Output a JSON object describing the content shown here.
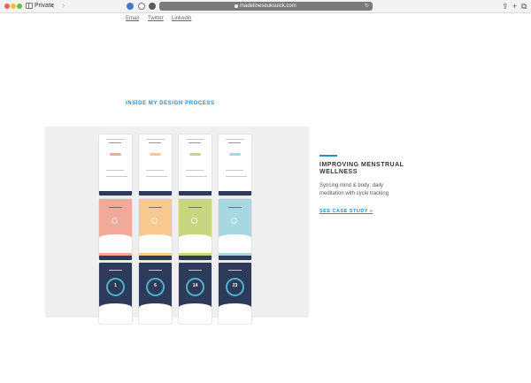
{
  "browser": {
    "mode_label": "Private",
    "address": "madelineseuksuick.com",
    "back_glyph": "‹",
    "forward_glyph": "›",
    "reload_glyph": "↻",
    "share_glyph": "⇪",
    "newtab_glyph": "+",
    "tabs_glyph": "⧉"
  },
  "social_links": [
    "Email",
    "Twitter",
    "Linkedin"
  ],
  "section": {
    "heading": "INSIDE MY DESIGN PROCESS"
  },
  "project": {
    "title": "IMPROVING MENSTRUAL WELLNESS",
    "description": "Syncing mind & body: daily meditation with cycle tracking",
    "link_label": "SEE CASE STUDY »",
    "phase_colors": [
      "#f1a999",
      "#f7c98e",
      "#c8d67f",
      "#a7d8e2"
    ],
    "day_numbers": [
      "1",
      "6",
      "14",
      "23"
    ]
  },
  "colors": {
    "accent": "#2f8ac8",
    "navy": "#2e3a5a",
    "panel_bg": "#efefef"
  }
}
